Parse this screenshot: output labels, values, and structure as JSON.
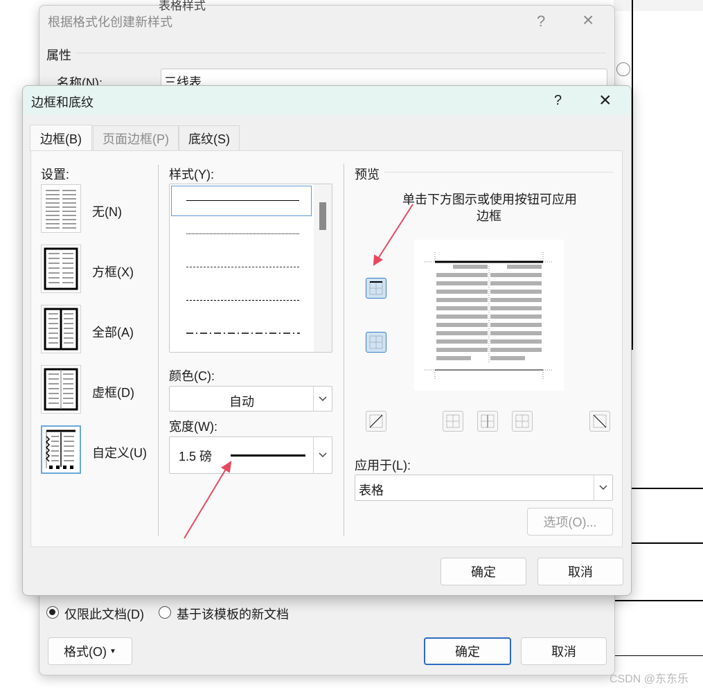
{
  "outer_dialog": {
    "title_text": "根据格式化创建新样式",
    "help_symbol": "?",
    "close_symbol": "×",
    "section_title": "属性",
    "name_label": "名称(N):",
    "name_value": "三线表",
    "radio_doc_only": "仅限此文档(D)",
    "radio_template": "基于该模板的新文档",
    "format_button": "格式(O)",
    "ok_button": "确定",
    "cancel_button": "取消",
    "truncated_top_text": "表格样式"
  },
  "dialog": {
    "title": "边框和底纹",
    "help_symbol": "?",
    "close_symbol": "×",
    "tabs": [
      {
        "label": "边框(B)",
        "active": true
      },
      {
        "label": "页面边框(P)",
        "active": false
      },
      {
        "label": "底纹(S)",
        "active": false
      }
    ],
    "settings": {
      "header": "设置:",
      "items": [
        {
          "label": "无(N)",
          "selected": false
        },
        {
          "label": "方框(X)",
          "selected": false
        },
        {
          "label": "全部(A)",
          "selected": false
        },
        {
          "label": "虚框(D)",
          "selected": false
        },
        {
          "label": "自定义(U)",
          "selected": true
        }
      ]
    },
    "style": {
      "header": "样式(Y):",
      "line_styles": [
        "solid",
        "dotted",
        "dashed-fine",
        "dashed",
        "dash-dot"
      ]
    },
    "color": {
      "label": "颜色(C):",
      "value": "自动"
    },
    "width": {
      "label": "宽度(W):",
      "value": "1.5 磅"
    },
    "preview": {
      "header": "预览",
      "hint_line1": "单击下方图示或使用按钮可应用",
      "hint_line2": "边框"
    },
    "apply_to": {
      "label": "应用于(L):",
      "value": "表格"
    },
    "options_button": "选项(O)...",
    "ok_button": "确定",
    "cancel_button": "取消"
  },
  "watermark": "CSDN @东东乐",
  "colors": {
    "accent": "#2b6bc4",
    "arrow": "#e8485f",
    "title_bar": "#e6f4f2",
    "toggle_on": "#cfe3f4"
  }
}
